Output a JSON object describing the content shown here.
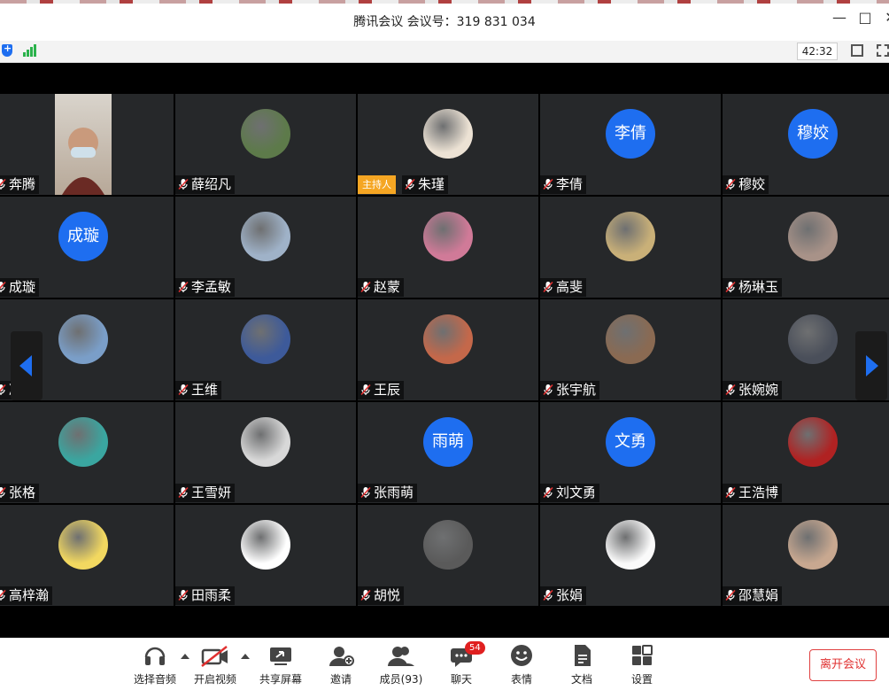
{
  "window": {
    "title": "腾讯会议  会议号：319 831 034"
  },
  "status": {
    "timer": "42:32"
  },
  "host_label": "主持人",
  "tiles": [
    {
      "name": "奔腾",
      "avatar": "video",
      "color": "#8a7a6a"
    },
    {
      "name": "薛绍凡",
      "avatar": "photo",
      "color": "#5d7a4a"
    },
    {
      "name": "朱瑾",
      "avatar": "photo",
      "color": "#ece2d4",
      "host": true
    },
    {
      "name": "李倩",
      "avatar_text": "李倩"
    },
    {
      "name": "穆姣",
      "avatar_text": "穆姣"
    },
    {
      "name": "成璇",
      "avatar_text": "成璇"
    },
    {
      "name": "李孟敏",
      "avatar": "photo",
      "color": "#9fb2c8"
    },
    {
      "name": "赵蒙",
      "avatar": "photo",
      "color": "#d07a98"
    },
    {
      "name": "高斐",
      "avatar": "photo",
      "color": "#c9b078"
    },
    {
      "name": "杨琳玉",
      "avatar": "photo",
      "color": "#a89288"
    },
    {
      "name": "冯琛",
      "avatar": "photo",
      "color": "#7a9ec8"
    },
    {
      "name": "王维",
      "avatar": "photo",
      "color": "#3d5a9a"
    },
    {
      "name": "王辰",
      "avatar": "photo",
      "color": "#c4684a"
    },
    {
      "name": "张宇航",
      "avatar": "photo",
      "color": "#8a6a52"
    },
    {
      "name": "张婉婉",
      "avatar": "photo",
      "color": "#4a4f5a"
    },
    {
      "name": "张格",
      "avatar": "photo",
      "color": "#3aa6a0"
    },
    {
      "name": "王雪妍",
      "avatar": "photo",
      "color": "#d8d8d8"
    },
    {
      "name": "张雨萌",
      "avatar_text": "雨萌"
    },
    {
      "name": "刘文勇",
      "avatar_text": "文勇"
    },
    {
      "name": "王浩博",
      "avatar": "photo",
      "color": "#b02222"
    },
    {
      "name": "高梓瀚",
      "avatar": "photo",
      "color": "#f2d860"
    },
    {
      "name": "田雨柔",
      "avatar": "photo",
      "color": "#ffffff"
    },
    {
      "name": "胡悦",
      "avatar": "photo",
      "color": "#5a5a5a"
    },
    {
      "name": "张娟",
      "avatar": "photo",
      "color": "#fafafa"
    },
    {
      "name": "邵慧娟",
      "avatar": "photo",
      "color": "#c8a890"
    }
  ],
  "toolbar": {
    "audio": "选择音频",
    "video": "开启视频",
    "share": "共享屏幕",
    "invite": "邀请",
    "members": "成员(93)",
    "chat": "聊天",
    "chat_badge": "54",
    "reaction": "表情",
    "docs": "文档",
    "settings": "设置",
    "leave": "离开会议"
  },
  "colors": {
    "accent": "#1e6ef0",
    "tile_bg": "#26282a",
    "danger": "#e03030",
    "host": "#f5a623"
  }
}
